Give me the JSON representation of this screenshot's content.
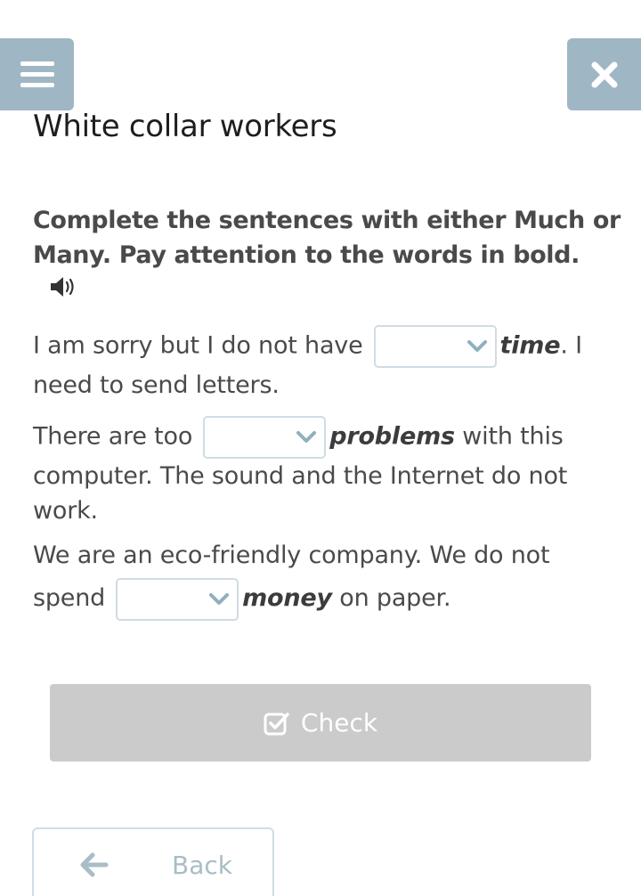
{
  "header": {
    "menu_icon": "hamburger-icon",
    "close_icon": "close-icon"
  },
  "title": "White collar workers",
  "instruction": "Complete the sentences with either Much or Many. Pay attention to the words in bold.",
  "audio_icon": "speaker-icon",
  "sentences": [
    {
      "before": "I am sorry but I do not have",
      "bold": "time",
      "after": ". I need to send letters.",
      "dropdown_value": ""
    },
    {
      "before": "There are too",
      "bold": "problems",
      "after": " with this computer. The sound and the Internet do not work.",
      "dropdown_value": ""
    },
    {
      "before": "We are an eco-friendly company. We do not spend",
      "bold": "money",
      "after": " on paper.",
      "dropdown_value": ""
    }
  ],
  "buttons": {
    "check": "Check",
    "back": "Back"
  },
  "colors": {
    "header_button": "#9fb7c4",
    "check_disabled": "#cbcbcb",
    "accent": "#8fb0bf"
  }
}
